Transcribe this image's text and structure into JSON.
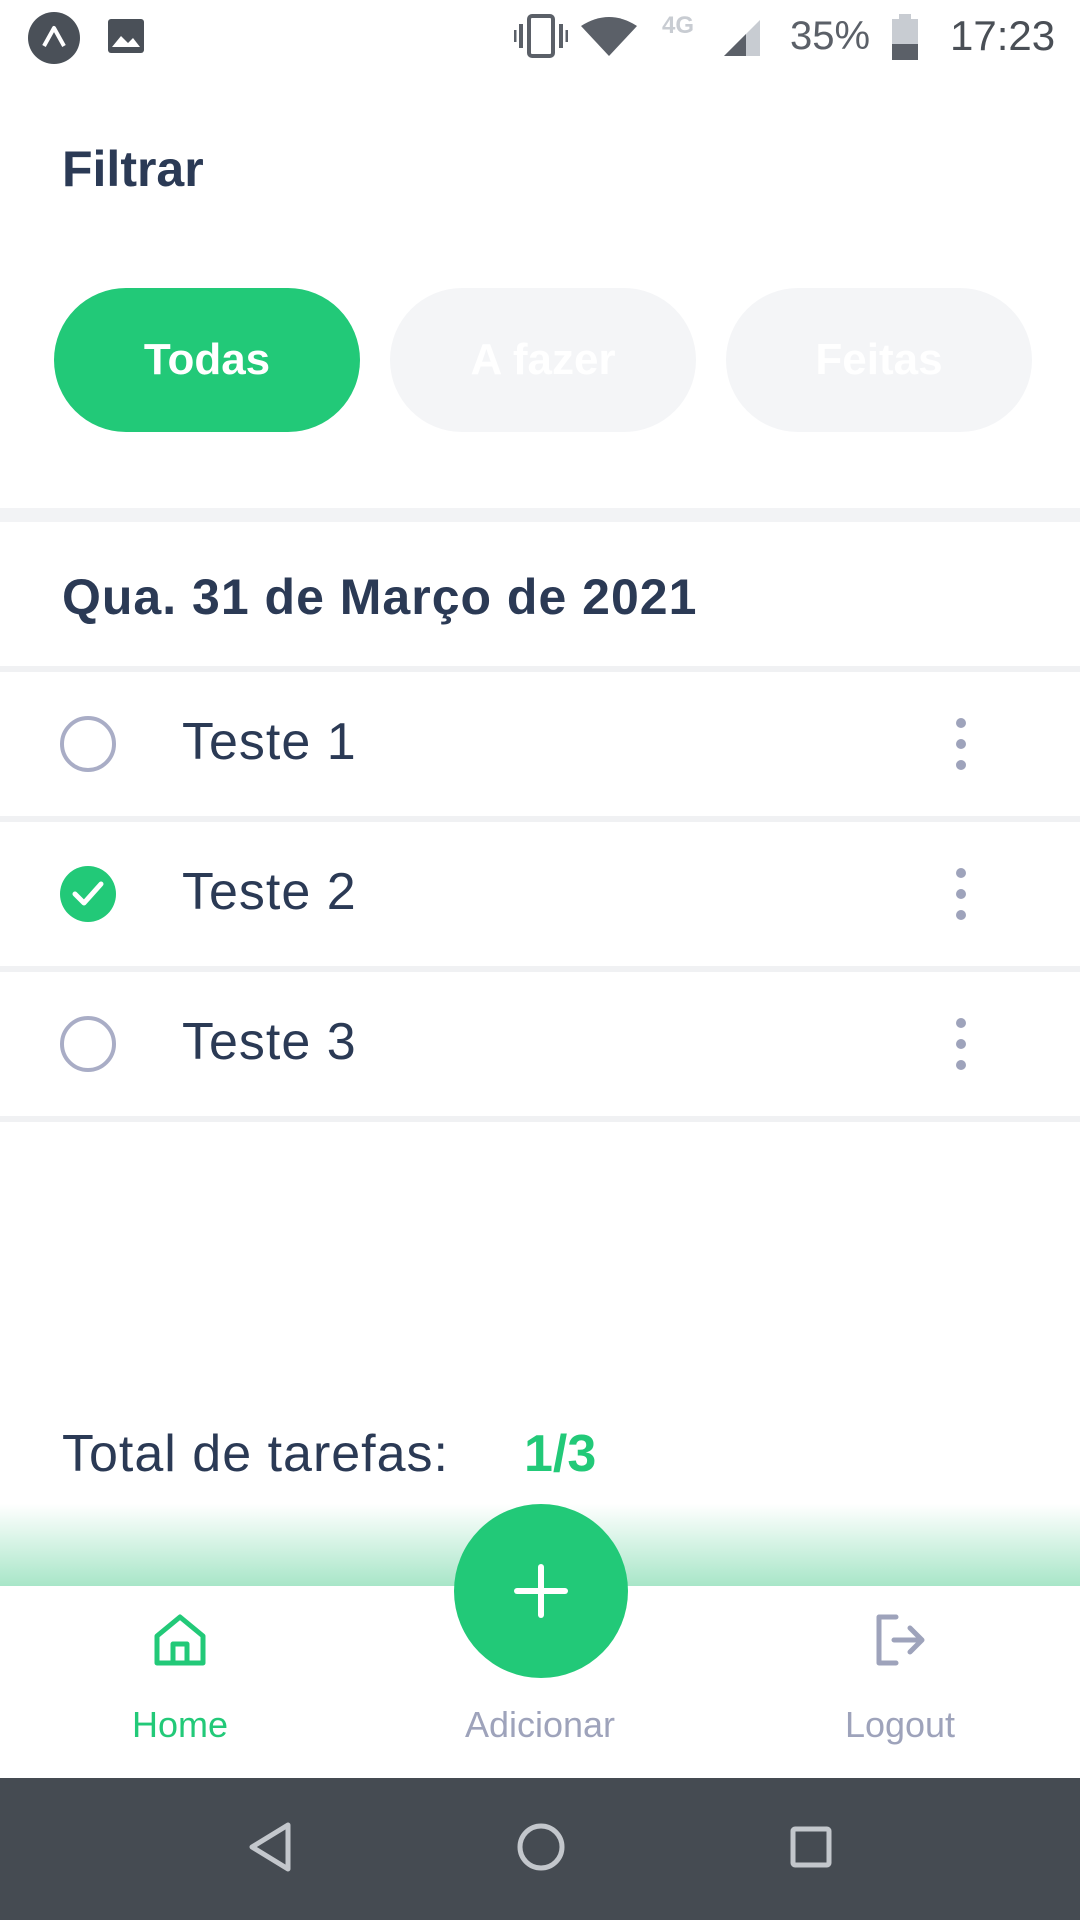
{
  "status_bar": {
    "network": "4G",
    "battery_percent": "35%",
    "time": "17:23",
    "icons": [
      "app-notification-icon",
      "image-notification-icon",
      "vibrate-icon",
      "wifi-icon",
      "signal-icon",
      "battery-icon"
    ]
  },
  "filter": {
    "title": "Filtrar",
    "chips": [
      {
        "label": "Todas",
        "active": true
      },
      {
        "label": "A fazer",
        "active": false
      },
      {
        "label": "Feitas",
        "active": false
      }
    ]
  },
  "date_header": "Qua. 31 de Março de 2021",
  "tasks": [
    {
      "label": "Teste 1",
      "done": false
    },
    {
      "label": "Teste 2",
      "done": true
    },
    {
      "label": "Teste 3",
      "done": false
    }
  ],
  "summary": {
    "label": "Total de tarefas:",
    "value": "1/3"
  },
  "bottom_nav": {
    "home_label": "Home",
    "add_label": "Adicionar",
    "logout_label": "Logout"
  },
  "colors": {
    "accent": "#22c978",
    "text": "#2b3a55",
    "muted": "#9ea3bb",
    "chip_inactive": "#f4f5f7",
    "system_nav": "#454b52"
  }
}
